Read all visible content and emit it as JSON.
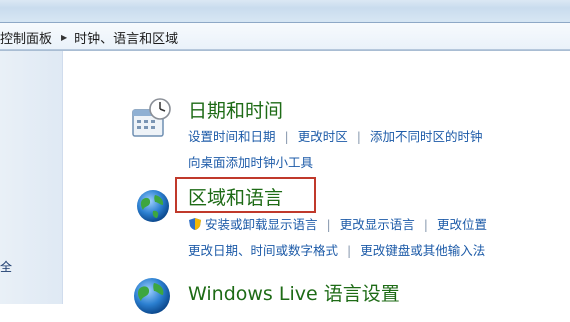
{
  "breadcrumb": {
    "items": [
      "控制面板",
      "时钟、语言和区域"
    ]
  },
  "left_pane": {
    "partial_item": "全"
  },
  "categories": [
    {
      "title": "日期和时间",
      "icon": "calendar-clock-icon",
      "links": [
        [
          "设置时间和日期",
          "更改时区",
          "添加不同时区的时钟"
        ],
        [
          "向桌面添加时钟小工具"
        ]
      ]
    },
    {
      "title": "区域和语言",
      "icon": "globe-icon",
      "links": [
        [
          "安装或卸载显示语言",
          "更改显示语言",
          "更改位置"
        ],
        [
          "更改日期、时间或数字格式",
          "更改键盘或其他输入法"
        ]
      ]
    },
    {
      "title": "Windows Live 语言设置",
      "icon": "globe-icon"
    }
  ],
  "colors": {
    "title_green": "#1e6b16",
    "link_blue": "#1d5ba8",
    "highlight_red": "#c0392b"
  }
}
